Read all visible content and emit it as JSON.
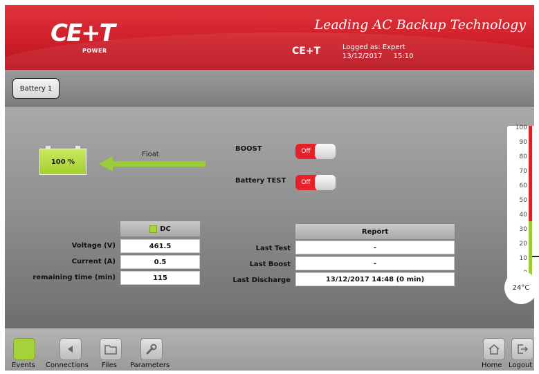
{
  "header": {
    "logo_text": "CE+T",
    "logo_sub": "POWER",
    "tagline": "Leading AC Backup Technology",
    "brand": "CE+T",
    "logged_as": "Logged as: Expert",
    "date": "13/12/2017",
    "time": "15:10"
  },
  "tabs": [
    {
      "label": "Battery 1"
    }
  ],
  "battery": {
    "charge_text": "100 %",
    "charge_fraction": 1.0,
    "state_label": "Float"
  },
  "controls": {
    "boost_label": "BOOST",
    "boost_state": "Off",
    "battery_test_label": "Battery TEST",
    "battery_test_state": "Off"
  },
  "dc": {
    "header": "DC",
    "led_color": "#a8d23a",
    "rows": [
      {
        "label": "Voltage (V)",
        "value": "461.5"
      },
      {
        "label": "Current (A)",
        "value": "0.5"
      },
      {
        "label": "remaining time (min)",
        "value": "115"
      }
    ]
  },
  "report": {
    "header": "Report",
    "rows": [
      {
        "label": "Last Test",
        "value": "-"
      },
      {
        "label": "Last Boost",
        "value": "-"
      },
      {
        "label": "Last Discharge",
        "value": "13/12/2017 14:48 (0 min)"
      }
    ]
  },
  "thermometer": {
    "ticks": [
      "100",
      "90",
      "80",
      "70",
      "60",
      "50",
      "40",
      "30",
      "20",
      "10",
      "0"
    ],
    "temperature": "24°C",
    "colors": {
      "warning": "#d7232a",
      "normal": "#9dcb3a"
    }
  },
  "footer": {
    "events": "Events",
    "connections": "Connections",
    "files": "Files",
    "parameters": "Parameters",
    "home": "Home",
    "logout": "Logout"
  },
  "colors": {
    "header_red": "#cf1f2a",
    "accent_green": "#a5d13a",
    "toggle_off": "#e8202a"
  }
}
